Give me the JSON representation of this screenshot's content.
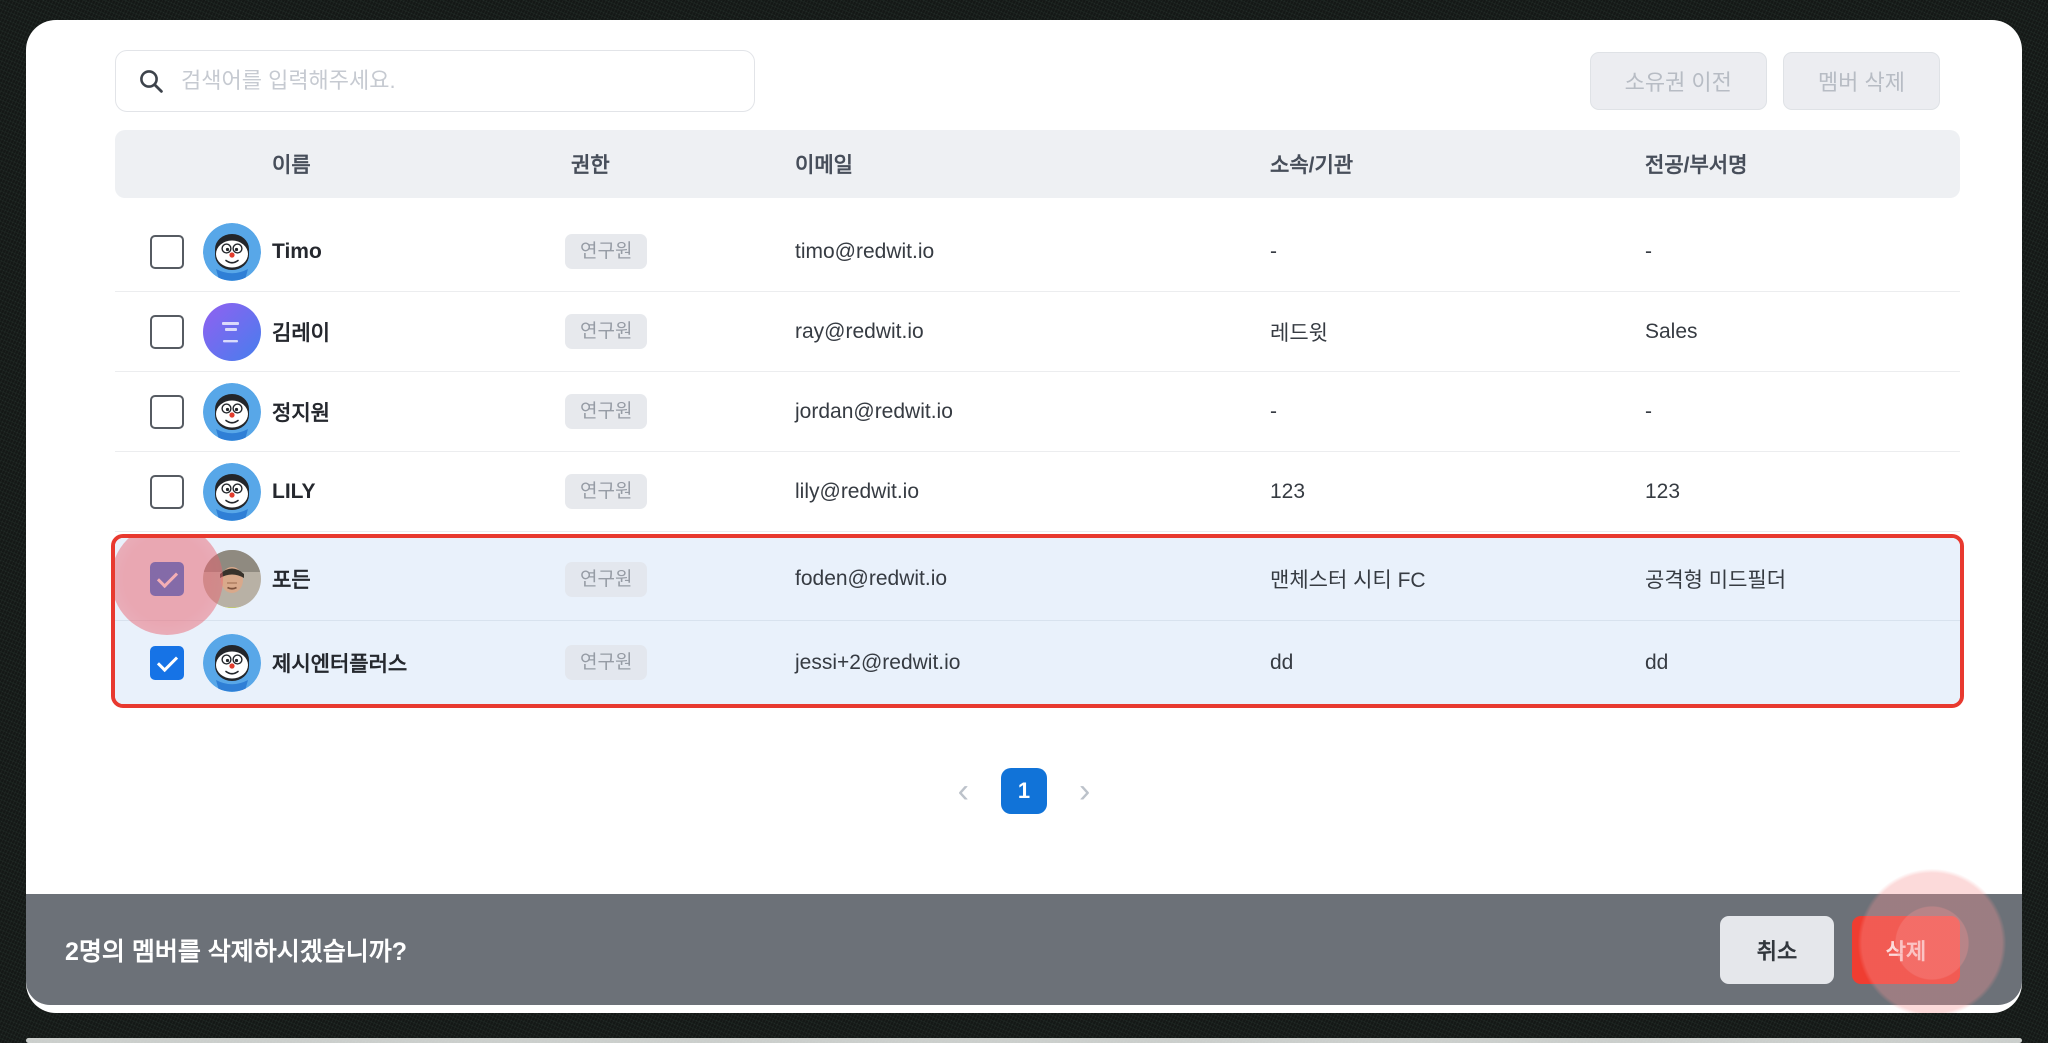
{
  "search": {
    "placeholder": "검색어를 입력해주세요."
  },
  "toolbar": {
    "transfer_ownership_label": "소유권 이전",
    "delete_member_label": "멤버 삭제"
  },
  "table": {
    "headers": [
      "이름",
      "권한",
      "이메일",
      "소속/기관",
      "전공/부서명"
    ],
    "rows": [
      {
        "name": "Timo",
        "role": "연구원",
        "email": "timo@redwit.io",
        "org": "-",
        "dept": "-",
        "avatar": "mascot",
        "checked": false,
        "selected": false,
        "highlight": false
      },
      {
        "name": "김레이",
        "role": "연구원",
        "email": "ray@redwit.io",
        "org": "레드윗",
        "dept": "Sales",
        "avatar": "gradient",
        "checked": false,
        "selected": false,
        "highlight": false
      },
      {
        "name": "정지원",
        "role": "연구원",
        "email": "jordan@redwit.io",
        "org": "-",
        "dept": "-",
        "avatar": "mascot",
        "checked": false,
        "selected": false,
        "highlight": false
      },
      {
        "name": "LILY",
        "role": "연구원",
        "email": "lily@redwit.io",
        "org": "123",
        "dept": "123",
        "avatar": "mascot",
        "checked": false,
        "selected": false,
        "highlight": false
      },
      {
        "name": "포든",
        "role": "연구원",
        "email": "foden@redwit.io",
        "org": "맨체스터 시티 FC",
        "dept": "공격형 미드필더",
        "avatar": "photo",
        "checked": true,
        "selected": true,
        "highlight": true
      },
      {
        "name": "제시엔터플러스",
        "role": "연구원",
        "email": "jessi+2@redwit.io",
        "org": "dd",
        "dept": "dd",
        "avatar": "mascot",
        "checked": true,
        "selected": true,
        "highlight": false
      }
    ]
  },
  "pagination": {
    "prev": "‹",
    "current": "1",
    "next": "›"
  },
  "footer": {
    "message": "2명의 멤버를 삭제하시겠습니까?",
    "cancel_label": "취소",
    "delete_label": "삭제"
  },
  "colors": {
    "accent_blue": "#1173d8",
    "checkbox_blue": "#1673e6",
    "danger_red": "#ef3d31",
    "selection_outline_red": "#e8392f",
    "selected_row_bg": "#e9f1fb",
    "footer_bar_bg": "#6c7178",
    "header_bg": "#eef0f3",
    "click_indicator_pink": "#e96370"
  }
}
